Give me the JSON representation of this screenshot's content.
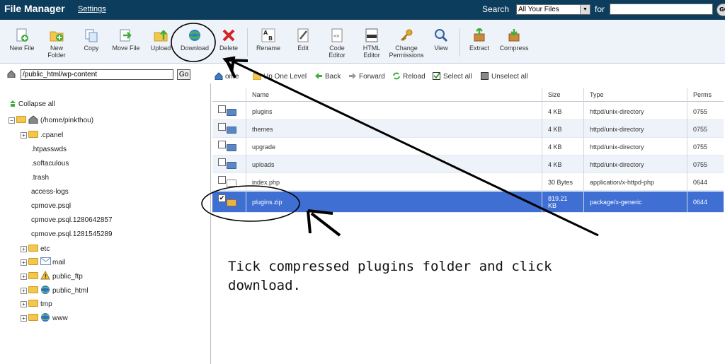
{
  "topbar": {
    "title": "File Manager",
    "settings_label": "Settings",
    "search_label": "Search",
    "search_scope": "All Your Files",
    "for_label": "for",
    "search_value": "",
    "go_label": "GO"
  },
  "toolbar": {
    "new_file": "New File",
    "new_folder_1": "New",
    "new_folder_2": "Folder",
    "copy": "Copy",
    "move_file": "Move File",
    "upload": "Upload",
    "download": "Download",
    "delete": "Delete",
    "rename": "Rename",
    "edit": "Edit",
    "code_editor_1": "Code",
    "code_editor_2": "Editor",
    "html_editor_1": "HTML",
    "html_editor_2": "Editor",
    "change_perm_1": "Change",
    "change_perm_2": "Permissions",
    "view": "View",
    "extract": "Extract",
    "compress": "Compress"
  },
  "pathbar": {
    "path": "/public_html/wp-content",
    "go_label": "Go"
  },
  "nav": {
    "home": "ome",
    "up_one_level": "Up One Level",
    "back": "Back",
    "forward": "Forward",
    "reload": "Reload",
    "select_all": "Select all",
    "unselect_all": "Unselect all"
  },
  "tree": {
    "collapse_all": "Collapse all",
    "root": "(/home/pinkthou)",
    "items": [
      ".cpanel",
      ".htpasswds",
      ".softaculous",
      ".trash",
      "access-logs",
      "cpmove.psql",
      "cpmove.psql.1280642857",
      "cpmove.psql.1281545289",
      "etc",
      "mail",
      "public_ftp",
      "public_html",
      "tmp",
      "www"
    ]
  },
  "files": {
    "headers": {
      "name": "Name",
      "size": "Size",
      "type": "Type",
      "perms": "Perms"
    },
    "rows": [
      {
        "name": "plugins",
        "size": "4 KB",
        "type": "httpd/unix-directory",
        "perms": "0755"
      },
      {
        "name": "themes",
        "size": "4 KB",
        "type": "httpd/unix-directory",
        "perms": "0755"
      },
      {
        "name": "upgrade",
        "size": "4 KB",
        "type": "httpd/unix-directory",
        "perms": "0755"
      },
      {
        "name": "uploads",
        "size": "4 KB",
        "type": "httpd/unix-directory",
        "perms": "0755"
      },
      {
        "name": "index.php",
        "size": "30 Bytes",
        "type": "application/x-httpd-php",
        "perms": "0644"
      },
      {
        "name": "plugins.zip",
        "size_1": "819.21",
        "size_2": "KB",
        "type": "package/x-generic",
        "perms": "0644"
      }
    ]
  },
  "annotation": {
    "line1": "Tick compressed plugins folder and click",
    "line2": "download."
  },
  "colors": {
    "topbar": "#0d3d5c",
    "selected_row": "#3f6fd3",
    "folder": "#f3c64d",
    "file_folder": "#5a86c2"
  }
}
